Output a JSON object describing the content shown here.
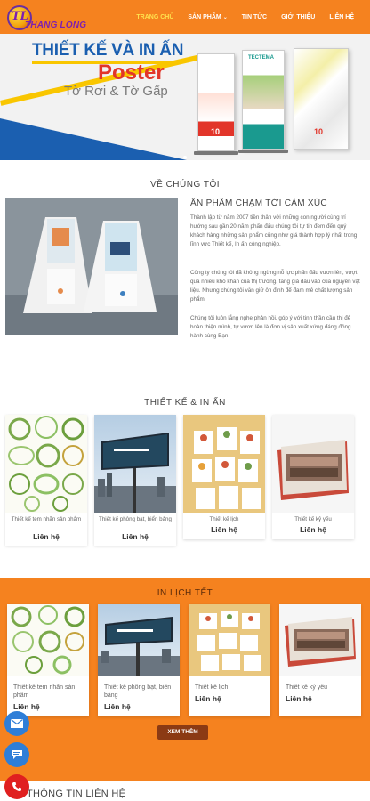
{
  "logo": {
    "mark": "TL",
    "name": "THANG LONG"
  },
  "nav": [
    {
      "label": "TRANG CHỦ",
      "active": true
    },
    {
      "label": "SẢN PHẨM",
      "dropdown": true
    },
    {
      "label": "TIN TỨC"
    },
    {
      "label": "GIỚI THIỆU"
    },
    {
      "label": "LIÊN HỆ"
    }
  ],
  "banner": {
    "line1": "THIẾT KẾ VÀ IN ẤN",
    "line2": "Poster",
    "line3": "Tờ Rơi & Tờ Gấp",
    "rollups": [
      {
        "label": "10"
      },
      {
        "label": "TECTEMA"
      },
      {
        "label": "10"
      }
    ]
  },
  "about": {
    "section_title": "VỀ CHÚNG TÔI",
    "heading": "ẤN PHẨM CHẠM TỚI CẢM XÚC",
    "paragraphs": [
      "Thành lập từ năm 2007 tiền thân với những con người cùng trí hướng sau gần 20 năm phấn đấu chúng tôi tự tin đem đến quý khách hàng những sản phẩm cũng như giá thành hợp lý nhất trong lĩnh vực Thiết kế, In ấn công nghiệp.",
      "Công ty chúng tôi đã không ngừng nỗ lực phấn đấu vươn lên, vượt qua nhiều khó khăn của thị trường, tăng giá dầu vào của nguyên vật liệu. Nhưng chúng tôi vẫn giữ ôn định để đam mê chất lượng sản phẩm.",
      "Chúng tôi luôn lắng nghe phản hồi, góp ý với tinh thần cầu thị để hoàn thiện mình, tự vươn lên là đơn vị sản xuất xứng đáng đồng hành cùng Bạn."
    ]
  },
  "design": {
    "section_title": "THIẾT KẾ & IN ẤN",
    "items": [
      {
        "name": "Thiết kế tem nhãn sản phẩm",
        "link": "Liên hệ"
      },
      {
        "name": "Thiết kế phông bạt, biển bảng",
        "link": "Liên hệ"
      },
      {
        "name": "Thiết kế lịch",
        "link": "Liên hệ"
      },
      {
        "name": "Thiết kế kỷ yếu",
        "link": "Liên hệ"
      }
    ]
  },
  "printing": {
    "section_title": "IN LỊCH TẾT",
    "items": [
      {
        "name": "Thiết kế tem nhãn sản phẩm",
        "link": "Liên hệ"
      },
      {
        "name": "Thiết kế phông bạt, biển bảng",
        "link": "Liên hệ"
      },
      {
        "name": "Thiết kế lịch",
        "link": "Liên hệ"
      },
      {
        "name": "Thiết kế kỷ yếu",
        "link": "Liên hệ"
      }
    ],
    "more_label": "XEM THÊM"
  },
  "contact": {
    "title": "THÔNG TIN LIÊN HỆ"
  },
  "floating": {
    "icons": [
      "mail-icon",
      "message-icon",
      "phone-icon"
    ]
  },
  "colors": {
    "brand": "#f5821f",
    "blue": "#1b5fb0",
    "red": "#e2352a",
    "yellow": "#f9c600",
    "button": "#8b3a14"
  }
}
